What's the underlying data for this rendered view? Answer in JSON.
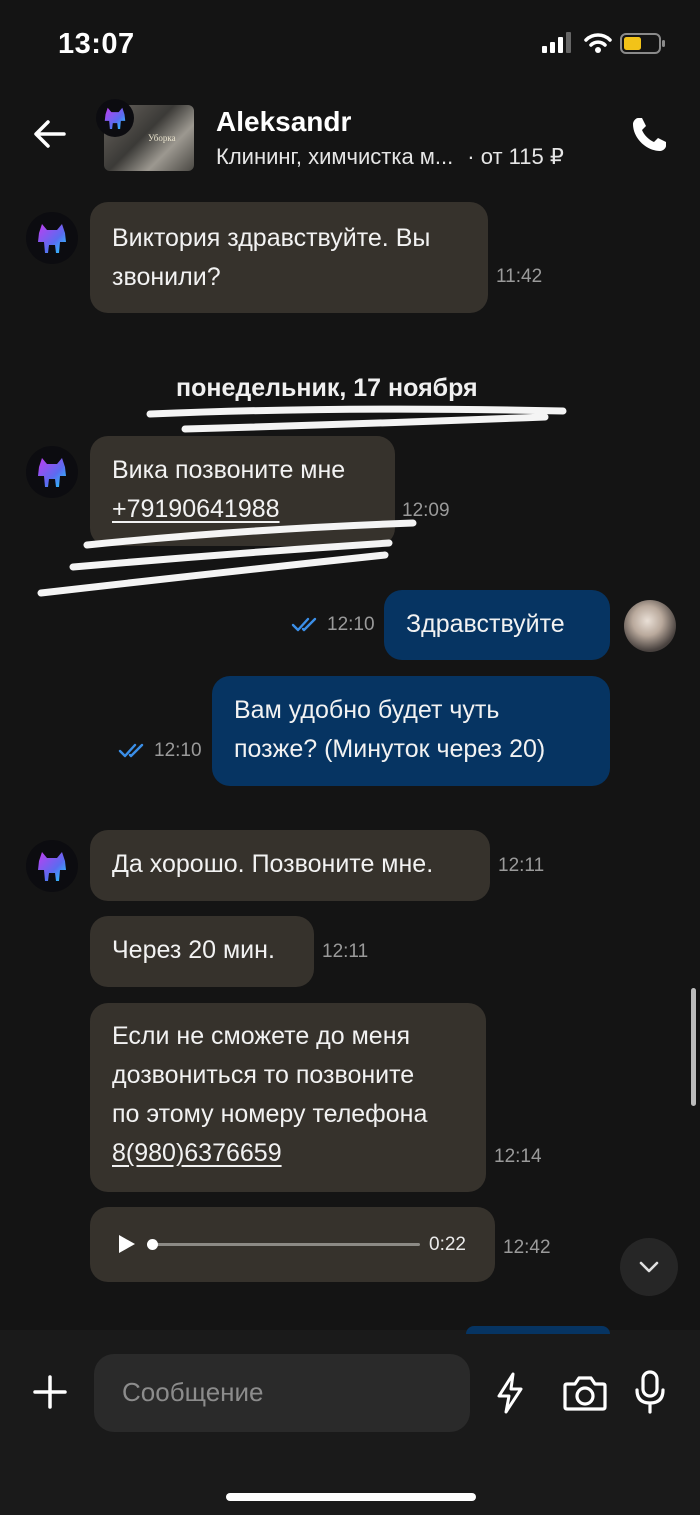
{
  "status_bar": {
    "time": "13:07"
  },
  "header": {
    "name": "Aleksandr",
    "service": "Клининг, химчистка м...",
    "price": "· от 115 ₽",
    "thumb_text": "Уборка"
  },
  "date_separator": "понедельник, 17 ноября",
  "messages": [
    {
      "direction": "in",
      "text": "Виктория здравствуйте. Вы\nзвонили?",
      "time": "11:42"
    },
    {
      "direction": "in",
      "text": "Вика позвоните мне",
      "link": "+79190641988",
      "time": "12:09"
    },
    {
      "direction": "out",
      "text": "Здравствуйте",
      "time": "12:10",
      "status": "read"
    },
    {
      "direction": "out",
      "text": "Вам удобно будет чуть\nпозже? (Минуток через 20)",
      "time": "12:10",
      "status": "read"
    },
    {
      "direction": "in",
      "text": "Да хорошо. Позвоните мне.",
      "time": "12:11"
    },
    {
      "direction": "in",
      "text": "Через 20 мин.",
      "time": "12:11"
    },
    {
      "direction": "in",
      "text": "Если не сможете до меня\nдозвониться то позвоните\nпо этому номеру телефона",
      "link": "8(980)6376659",
      "time": "12:14"
    },
    {
      "direction": "in",
      "type": "voice",
      "duration": "0:22",
      "progress": 0.0,
      "time": "12:42"
    }
  ],
  "composer": {
    "placeholder": "Сообщение"
  },
  "colors": {
    "background": "#141414",
    "incoming_bubble": "#36322c",
    "outgoing_bubble": "#063462",
    "read_check": "#3b8fe8"
  },
  "icons": [
    "back-arrow-icon",
    "phone-icon",
    "double-check-icon",
    "play-icon",
    "chevron-down-icon",
    "plus-icon",
    "lightning-icon",
    "camera-icon",
    "microphone-icon"
  ]
}
